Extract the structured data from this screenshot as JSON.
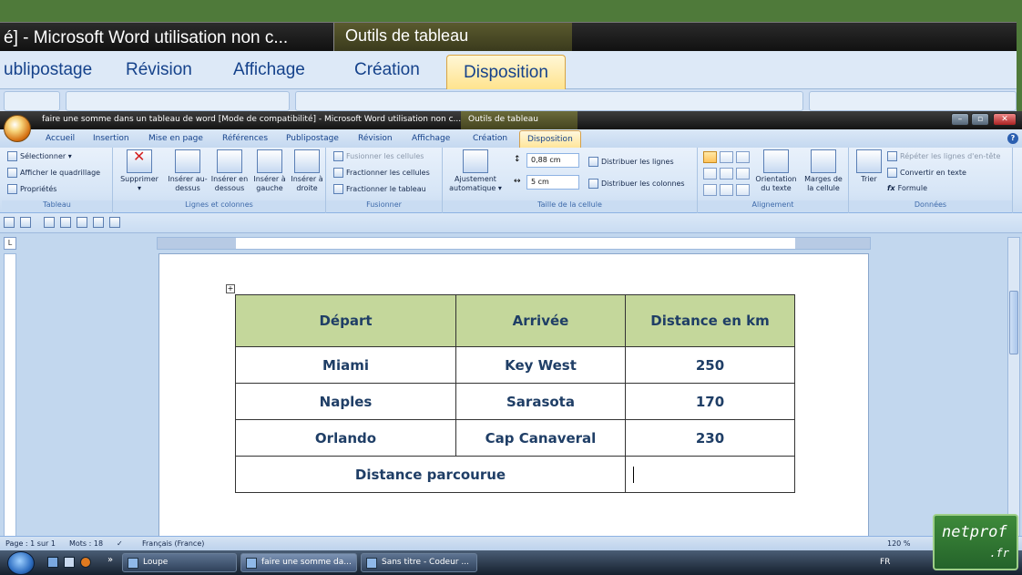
{
  "loupe": {
    "title": "é] - Microsoft Word utilisation non c...",
    "context_tab_header": "Outils de tableau",
    "tabs": [
      "ublipostage",
      "Révision",
      "Affichage",
      "Création",
      "Disposition"
    ]
  },
  "word": {
    "title": "faire une somme dans un tableau de word [Mode de compatibilité] - Microsoft Word utilisation non c...",
    "context_header": "Outils de tableau",
    "tabs": [
      "Accueil",
      "Insertion",
      "Mise en page",
      "Références",
      "Publipostage",
      "Révision",
      "Affichage",
      "Création",
      "Disposition"
    ],
    "ribbon": {
      "tableau": {
        "label": "Tableau",
        "items": [
          "Sélectionner ▾",
          "Afficher le quadrillage",
          "Propriétés"
        ]
      },
      "lignes_colonnes": {
        "label": "Lignes et colonnes",
        "supprimer": "Supprimer",
        "buttons": [
          "Insérer au-dessus",
          "Insérer en dessous",
          "Insérer à gauche",
          "Insérer à droite"
        ]
      },
      "fusionner": {
        "label": "Fusionner",
        "items": [
          "Fusionner les cellules",
          "Fractionner les cellules",
          "Fractionner le tableau"
        ]
      },
      "taille": {
        "label": "Taille de la cellule",
        "ajustement": "Ajustement automatique ▾",
        "height": "0,88 cm",
        "width": "5 cm",
        "distrib_lignes": "Distribuer les lignes",
        "distrib_colonnes": "Distribuer les colonnes"
      },
      "alignement": {
        "label": "Alignement",
        "orientation": "Orientation du texte",
        "marges": "Marges de la cellule"
      },
      "donnees": {
        "label": "Données",
        "trier": "Trier",
        "items": [
          "Répéter les lignes d'en-tête",
          "Convertir en texte",
          "Formule"
        ]
      }
    },
    "table": {
      "headers": [
        "Départ",
        "Arrivée",
        "Distance en km"
      ],
      "rows": [
        [
          "Miami",
          "Key West",
          "250"
        ],
        [
          "Naples",
          "Sarasota",
          "170"
        ],
        [
          "Orlando",
          "Cap Canaveral",
          "230"
        ]
      ],
      "total_label": "Distance parcourue"
    },
    "status": {
      "page": "Page : 1 sur 1",
      "words": "Mots : 18",
      "language": "Français (France)",
      "zoom": "120 %"
    }
  },
  "taskbar": {
    "items": [
      "Loupe",
      "faire une somme da...",
      "Sans titre - Codeur ..."
    ],
    "lang": "FR"
  },
  "watermark": {
    "line1": "netprof",
    "line2": ".fr"
  },
  "colors": {
    "header_fill": "#c4d79b",
    "table_text": "#1f3e66",
    "ribbon_bg": "#d6e5f6",
    "active_tab": "#ffe59a"
  }
}
